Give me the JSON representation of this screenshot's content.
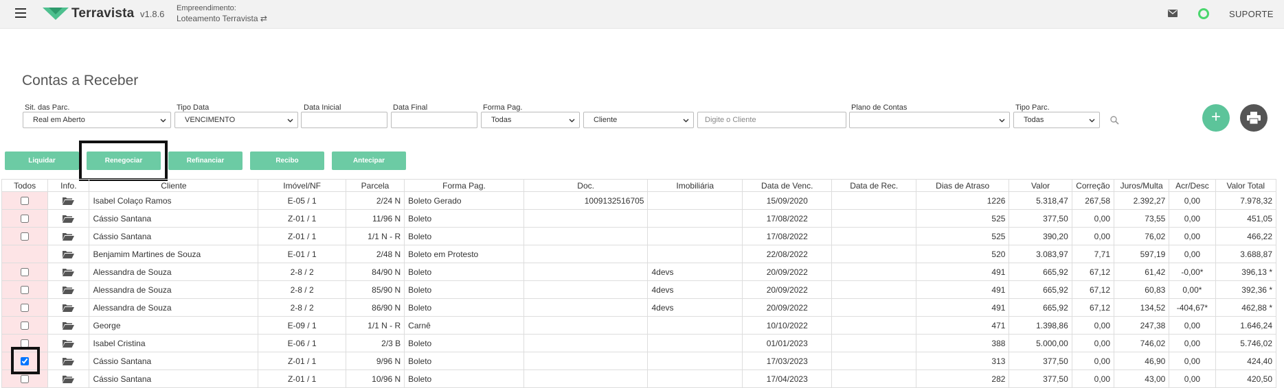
{
  "header": {
    "brand": "Terravista",
    "version": "v1.8.6",
    "empreendimento_label": "Empreendimento:",
    "empreendimento_value": "Loteamento Terravista ⇄",
    "suporte": "SUPORTE",
    "brand_color": "#4ec08f"
  },
  "page": {
    "title": "Contas a Receber"
  },
  "filters": {
    "sit_label": "Sit. das Parc.",
    "sit_value": "Real em Aberto",
    "tipo_data_label": "Tipo Data",
    "tipo_data_value": "VENCIMENTO",
    "data_inicial_label": "Data Inicial",
    "data_inicial_value": "",
    "data_final_label": "Data Final",
    "data_final_value": "",
    "forma_pag_label": "Forma Pag.",
    "forma_pag_value": "Todas",
    "cliente_select_value": "Cliente",
    "cliente_placeholder": "Digite o Cliente",
    "plano_label": "Plano de Contas",
    "plano_value": "",
    "tipo_parc_label": "Tipo Parc.",
    "tipo_parc_value": "Todas",
    "add_label": "+"
  },
  "actions": {
    "liquidar": "Liquidar",
    "renegociar": "Renegociar",
    "refinanciar": "Refinanciar",
    "recibo": "Recibo",
    "antecipar": "Antecipar"
  },
  "table": {
    "columns": [
      "Todos",
      "Info.",
      "Cliente",
      "Imóvel/NF",
      "Parcela",
      "Forma Pag.",
      "Doc.",
      "Imobiliária",
      "Data de Venc.",
      "Data de Rec.",
      "Dias de Atraso",
      "Valor",
      "Correção",
      "Juros/Multa",
      "Acr/Desc",
      "Valor Total"
    ],
    "rows": [
      {
        "checkbox": true,
        "checked": false,
        "cliente": "Isabel Colaço Ramos",
        "imovel": "E-05 / 1",
        "parcela": "2/24 N",
        "forma": "Boleto Gerado",
        "doc": "1009132516705",
        "imobiliaria": "",
        "venc": "15/09/2020",
        "rec": "",
        "dias": "1226",
        "valor": "5.318,47",
        "correcao": "267,58",
        "juros": "2.392,27",
        "acr": "0,00",
        "total": "7.978,32"
      },
      {
        "checkbox": true,
        "checked": false,
        "cliente": "Cássio Santana",
        "imovel": "Z-01 / 1",
        "parcela": "11/96 N",
        "forma": "Boleto",
        "doc": "",
        "imobiliaria": "",
        "venc": "17/08/2022",
        "rec": "",
        "dias": "525",
        "valor": "377,50",
        "correcao": "0,00",
        "juros": "73,55",
        "acr": "0,00",
        "total": "451,05"
      },
      {
        "checkbox": true,
        "checked": false,
        "cliente": "Cássio Santana",
        "imovel": "Z-01 / 1",
        "parcela": "1/1 N - R",
        "forma": "Boleto",
        "doc": "",
        "imobiliaria": "",
        "venc": "17/08/2022",
        "rec": "",
        "dias": "525",
        "valor": "390,20",
        "correcao": "0,00",
        "juros": "76,02",
        "acr": "0,00",
        "total": "466,22"
      },
      {
        "checkbox": false,
        "checked": false,
        "cliente": "Benjamim Martines de Souza",
        "imovel": "E-01 / 1",
        "parcela": "2/48 N",
        "forma": "Boleto em Protesto",
        "doc": "",
        "imobiliaria": "",
        "venc": "22/08/2022",
        "rec": "",
        "dias": "520",
        "valor": "3.083,97",
        "correcao": "7,71",
        "juros": "597,19",
        "acr": "0,00",
        "total": "3.688,87"
      },
      {
        "checkbox": true,
        "checked": false,
        "cliente": "Alessandra de Souza",
        "imovel": "2-8 / 2",
        "parcela": "84/90 N",
        "forma": "Boleto",
        "doc": "",
        "imobiliaria": "4devs",
        "venc": "20/09/2022",
        "rec": "",
        "dias": "491",
        "valor": "665,92",
        "correcao": "67,12",
        "juros": "61,42",
        "acr": "-0,00*",
        "total": "396,13 *"
      },
      {
        "checkbox": true,
        "checked": false,
        "cliente": "Alessandra de Souza",
        "imovel": "2-8 / 2",
        "parcela": "85/90 N",
        "forma": "Boleto",
        "doc": "",
        "imobiliaria": "4devs",
        "venc": "20/09/2022",
        "rec": "",
        "dias": "491",
        "valor": "665,92",
        "correcao": "67,12",
        "juros": "60,83",
        "acr": "0,00*",
        "total": "392,36 *"
      },
      {
        "checkbox": true,
        "checked": false,
        "cliente": "Alessandra de Souza",
        "imovel": "2-8 / 2",
        "parcela": "86/90 N",
        "forma": "Boleto",
        "doc": "",
        "imobiliaria": "4devs",
        "venc": "20/09/2022",
        "rec": "",
        "dias": "491",
        "valor": "665,92",
        "correcao": "67,12",
        "juros": "134,52",
        "acr": "-404,67*",
        "total": "462,88 *"
      },
      {
        "checkbox": true,
        "checked": false,
        "cliente": "George",
        "imovel": "E-09 / 1",
        "parcela": "1/1 N - R",
        "forma": "Carnê",
        "doc": "",
        "imobiliaria": "",
        "venc": "10/10/2022",
        "rec": "",
        "dias": "471",
        "valor": "1.398,86",
        "correcao": "0,00",
        "juros": "247,38",
        "acr": "0,00",
        "total": "1.646,24"
      },
      {
        "checkbox": true,
        "checked": false,
        "cliente": "Isabel Cristina",
        "imovel": "E-06 / 1",
        "parcela": "2/3 B",
        "forma": "Boleto",
        "doc": "",
        "imobiliaria": "",
        "venc": "01/01/2023",
        "rec": "",
        "dias": "388",
        "valor": "5.000,00",
        "correcao": "0,00",
        "juros": "746,02",
        "acr": "0,00",
        "total": "5.746,02"
      },
      {
        "checkbox": true,
        "checked": true,
        "cliente": "Cássio Santana",
        "imovel": "Z-01 / 1",
        "parcela": "9/96 N",
        "forma": "Boleto",
        "doc": "",
        "imobiliaria": "",
        "venc": "17/03/2023",
        "rec": "",
        "dias": "313",
        "valor": "377,50",
        "correcao": "0,00",
        "juros": "46,90",
        "acr": "0,00",
        "total": "424,40"
      },
      {
        "checkbox": true,
        "checked": false,
        "cliente": "Cássio Santana",
        "imovel": "Z-01 / 1",
        "parcela": "10/96 N",
        "forma": "Boleto",
        "doc": "",
        "imobiliaria": "",
        "venc": "17/04/2023",
        "rec": "",
        "dias": "282",
        "valor": "377,50",
        "correcao": "0,00",
        "juros": "43,00",
        "acr": "0,00",
        "total": "420,50"
      }
    ]
  }
}
